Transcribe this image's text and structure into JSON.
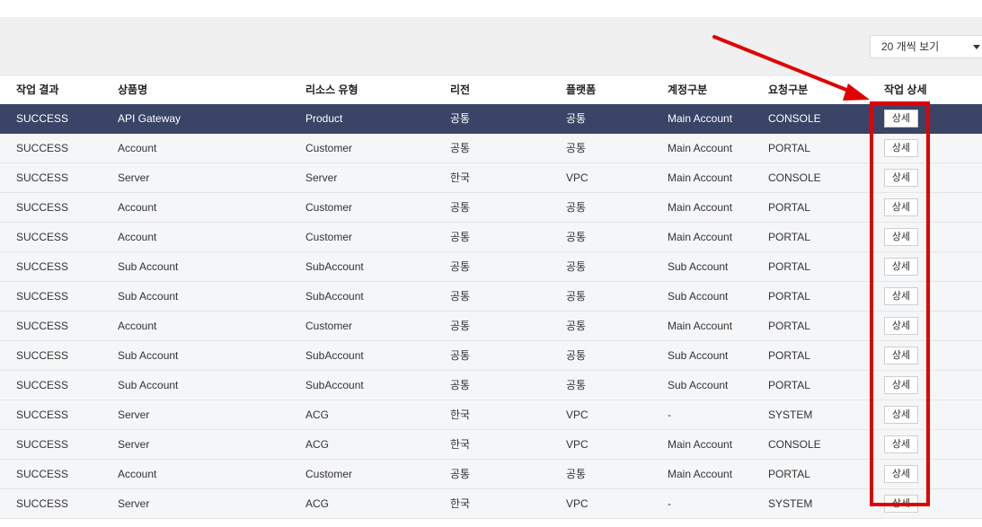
{
  "per_page": {
    "label": "20 개씩 보기"
  },
  "columns": [
    "작업 결과",
    "상품명",
    "리소스 유형",
    "리전",
    "플랫폼",
    "계정구분",
    "요청구분",
    "작업 상세"
  ],
  "detail_label": "상세",
  "rows": [
    [
      "SUCCESS",
      "API Gateway",
      "Product",
      "공통",
      "공통",
      "Main Account",
      "CONSOLE"
    ],
    [
      "SUCCESS",
      "Account",
      "Customer",
      "공통",
      "공통",
      "Main Account",
      "PORTAL"
    ],
    [
      "SUCCESS",
      "Server",
      "Server",
      "한국",
      "VPC",
      "Main Account",
      "CONSOLE"
    ],
    [
      "SUCCESS",
      "Account",
      "Customer",
      "공통",
      "공통",
      "Main Account",
      "PORTAL"
    ],
    [
      "SUCCESS",
      "Account",
      "Customer",
      "공통",
      "공통",
      "Main Account",
      "PORTAL"
    ],
    [
      "SUCCESS",
      "Sub Account",
      "SubAccount",
      "공통",
      "공통",
      "Sub Account",
      "PORTAL"
    ],
    [
      "SUCCESS",
      "Sub Account",
      "SubAccount",
      "공통",
      "공통",
      "Sub Account",
      "PORTAL"
    ],
    [
      "SUCCESS",
      "Account",
      "Customer",
      "공통",
      "공통",
      "Main Account",
      "PORTAL"
    ],
    [
      "SUCCESS",
      "Sub Account",
      "SubAccount",
      "공통",
      "공통",
      "Sub Account",
      "PORTAL"
    ],
    [
      "SUCCESS",
      "Sub Account",
      "SubAccount",
      "공통",
      "공통",
      "Sub Account",
      "PORTAL"
    ],
    [
      "SUCCESS",
      "Server",
      "ACG",
      "한국",
      "VPC",
      "-",
      "SYSTEM"
    ],
    [
      "SUCCESS",
      "Server",
      "ACG",
      "한국",
      "VPC",
      "Main Account",
      "CONSOLE"
    ],
    [
      "SUCCESS",
      "Account",
      "Customer",
      "공통",
      "공통",
      "Main Account",
      "PORTAL"
    ],
    [
      "SUCCESS",
      "Server",
      "ACG",
      "한국",
      "VPC",
      "-",
      "SYSTEM"
    ]
  ],
  "selected_row": 0,
  "colors": {
    "selected_row": "#3a4467",
    "annotation": "#e00000"
  }
}
